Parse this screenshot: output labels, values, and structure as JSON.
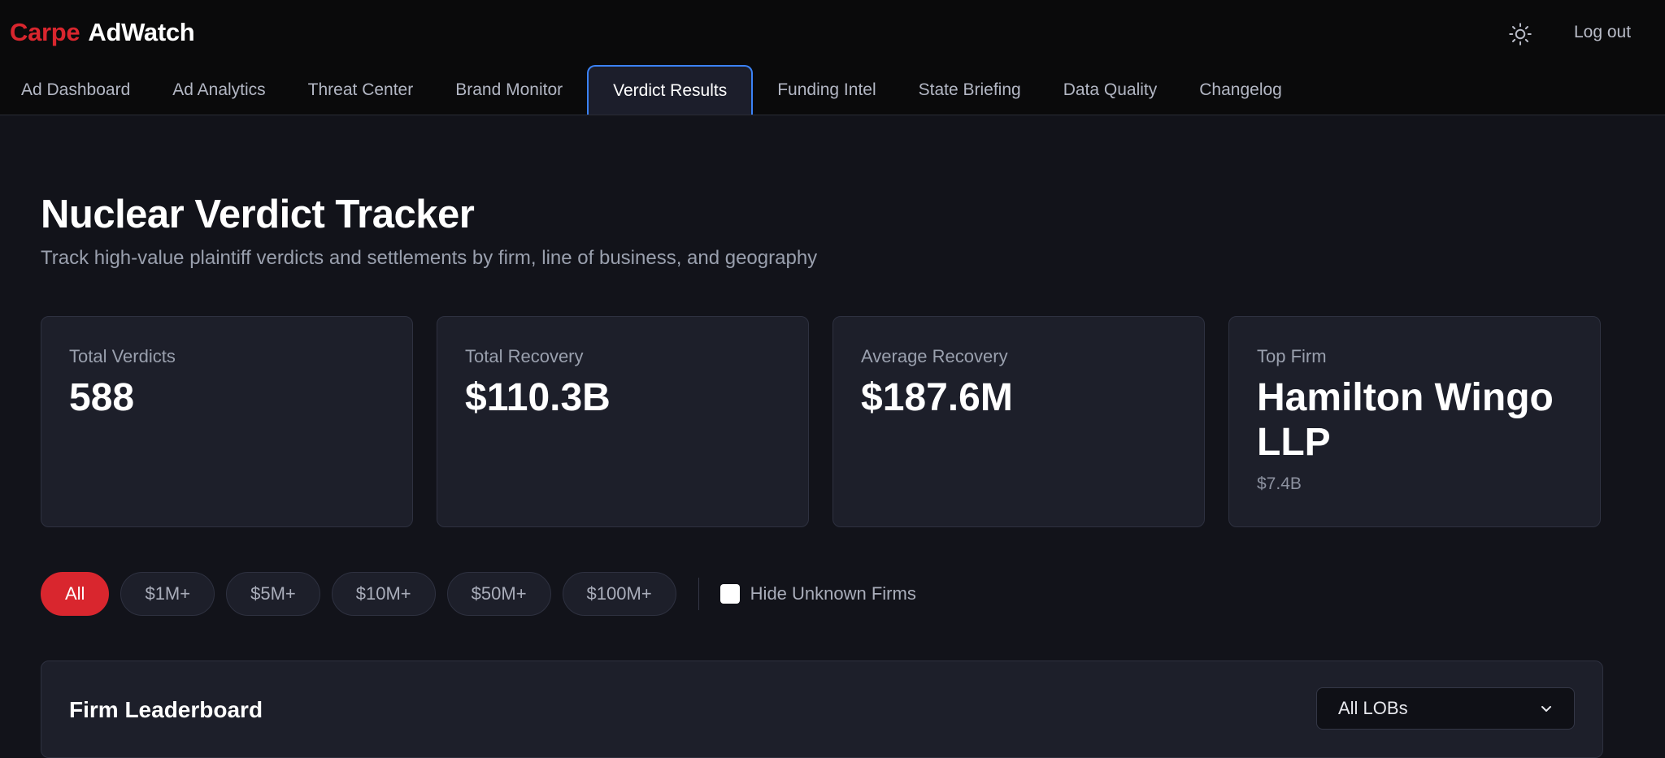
{
  "brand": {
    "part1": "Carpe",
    "part2": "AdWatch"
  },
  "header": {
    "logout_label": "Log out",
    "theme_icon": "sun-icon"
  },
  "tabs": [
    {
      "label": "Ad Dashboard"
    },
    {
      "label": "Ad Analytics"
    },
    {
      "label": "Threat Center"
    },
    {
      "label": "Brand Monitor"
    },
    {
      "label": "Verdict Results",
      "active": true
    },
    {
      "label": "Funding Intel"
    },
    {
      "label": "State Briefing"
    },
    {
      "label": "Data Quality"
    },
    {
      "label": "Changelog"
    }
  ],
  "page": {
    "title": "Nuclear Verdict Tracker",
    "subtitle": "Track high-value plaintiff verdicts and settlements by firm, line of business, and geography"
  },
  "stats": [
    {
      "label": "Total Verdicts",
      "value": "588"
    },
    {
      "label": "Total Recovery",
      "value": "$110.3B"
    },
    {
      "label": "Average Recovery",
      "value": "$187.6M"
    },
    {
      "label": "Top Firm",
      "value": "Hamilton Wingo LLP",
      "sub": "$7.4B"
    }
  ],
  "filters": {
    "chips": [
      "All",
      "$1M+",
      "$5M+",
      "$10M+",
      "$50M+",
      "$100M+"
    ],
    "active": "All",
    "checkbox_label": "Hide Unknown Firms"
  },
  "leaderboard": {
    "title": "Firm Leaderboard",
    "select_value": "All LOBs"
  },
  "colors": {
    "accent_red": "#d9262e",
    "tab_active_border": "#3b82f6",
    "background": "#12131a",
    "card": "#1d1f2a"
  }
}
